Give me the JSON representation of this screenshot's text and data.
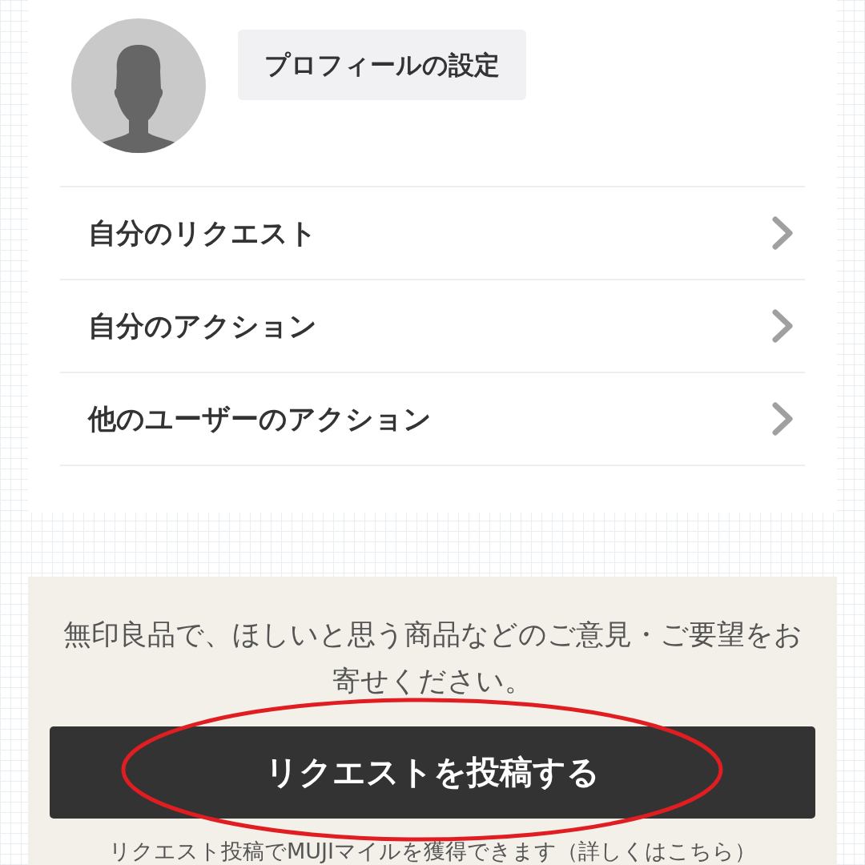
{
  "profile": {
    "settings_button": "プロフィールの設定"
  },
  "menu": [
    {
      "label": "自分のリクエスト"
    },
    {
      "label": "自分のアクション"
    },
    {
      "label": "他のユーザーのアクション"
    }
  ],
  "request_panel": {
    "message": "無印良品で、ほしいと思う商品などのご意見・ご要望をお寄せください。",
    "button": "リクエストを投稿する",
    "note": "リクエスト投稿でMUJIマイルを獲得できます（詳しくはこちら）"
  }
}
